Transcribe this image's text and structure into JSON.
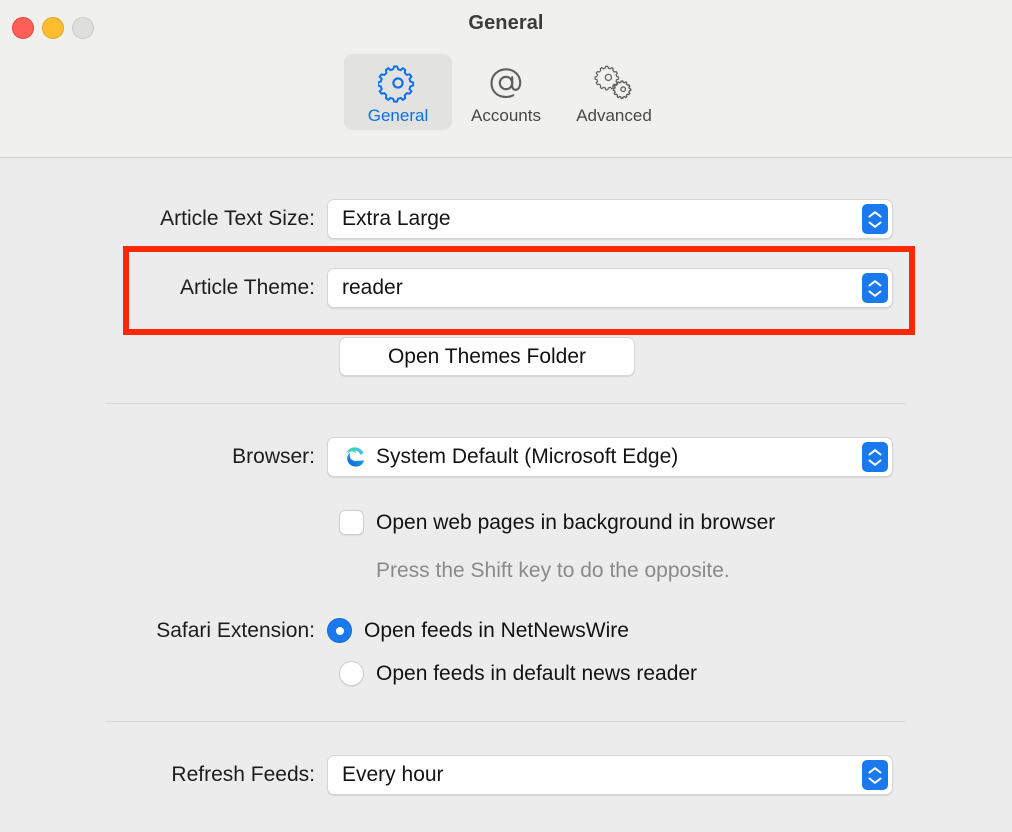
{
  "window": {
    "title": "General",
    "traffic_lights": [
      {
        "name": "close",
        "color": "#ff5f57"
      },
      {
        "name": "minimize",
        "color": "#febc2e"
      },
      {
        "name": "zoom",
        "color": "#dededd"
      }
    ]
  },
  "toolbar": {
    "tabs": [
      {
        "label": "General",
        "icon": "gear-icon",
        "selected": true
      },
      {
        "label": "Accounts",
        "icon": "at-sign-icon",
        "selected": false
      },
      {
        "label": "Advanced",
        "icon": "two-gears-icon",
        "selected": false
      }
    ]
  },
  "main": {
    "article_text_size": {
      "label": "Article Text Size:",
      "value": "Extra Large"
    },
    "article_theme": {
      "label": "Article Theme:",
      "value": "reader"
    },
    "open_themes_folder": {
      "label": "Open Themes Folder"
    },
    "browser": {
      "label": "Browser:",
      "value": "System Default (Microsoft Edge)",
      "icon": "microsoft-edge-icon"
    },
    "open_background": {
      "label": "Open web pages in background in browser",
      "checked": false
    },
    "shift_hint": "Press the Shift key to do the opposite.",
    "safari_extension": {
      "label": "Safari Extension:",
      "options": [
        {
          "label": "Open feeds in NetNewsWire",
          "selected": true
        },
        {
          "label": "Open feeds in default news reader",
          "selected": false
        }
      ]
    },
    "refresh_feeds": {
      "label": "Refresh Feeds:",
      "value": "Every hour"
    }
  },
  "annotation": {
    "highlight_color": "#fb2806"
  }
}
